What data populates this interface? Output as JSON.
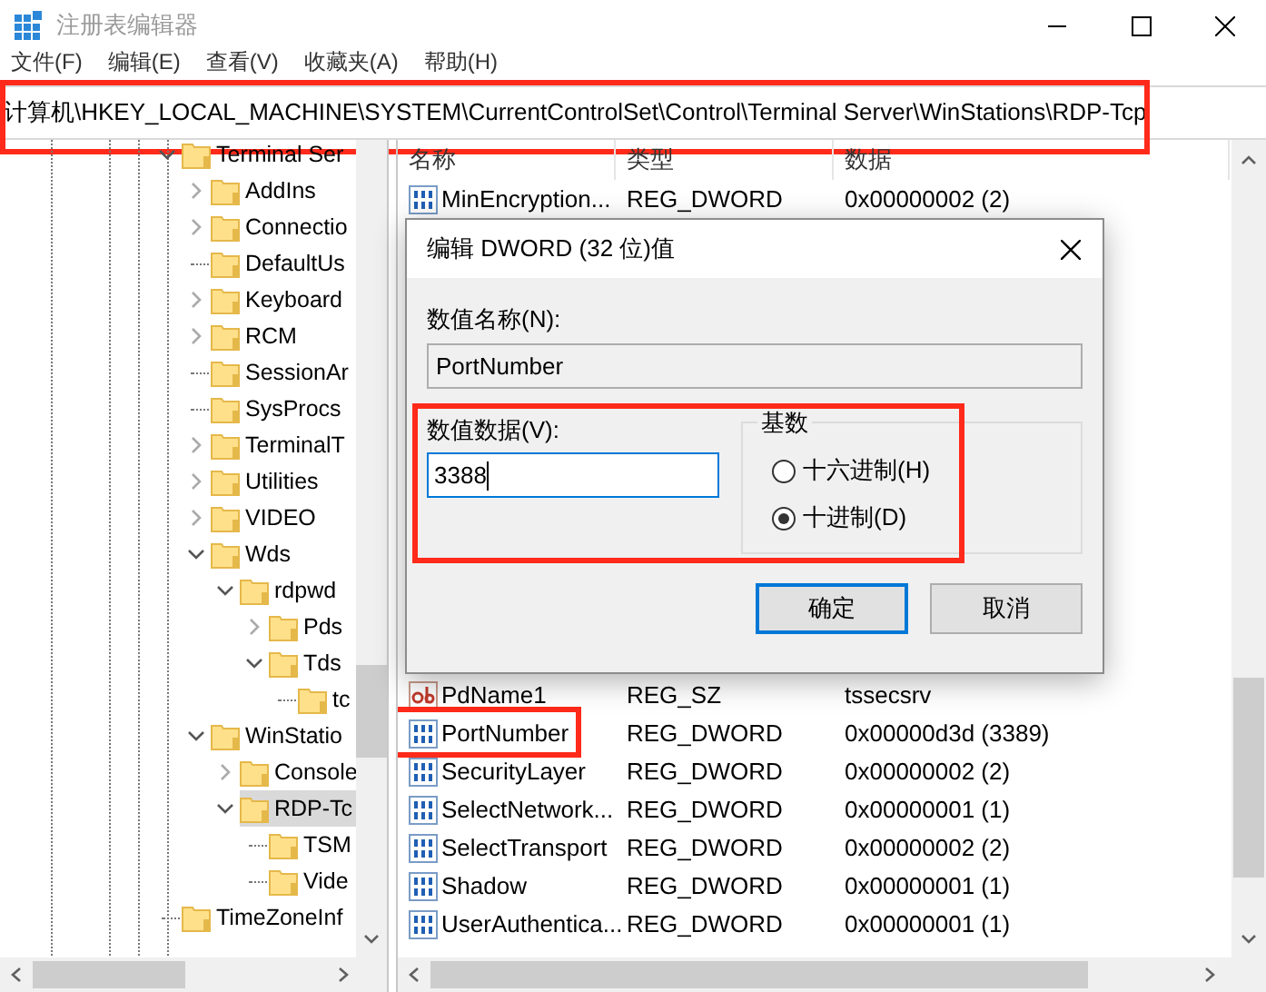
{
  "window": {
    "title": "注册表编辑器"
  },
  "menu": [
    "文件(F)",
    "编辑(E)",
    "查看(V)",
    "收藏夹(A)",
    "帮助(H)"
  ],
  "address_bar": {
    "value": "计算机\\HKEY_LOCAL_MACHINE\\SYSTEM\\CurrentControlSet\\Control\\Terminal Server\\WinStations\\RDP-Tcp",
    "highlighted": true
  },
  "tree": [
    {
      "label": "Terminal Ser",
      "kind": "branch",
      "expanded": true,
      "selected": false,
      "children": [
        {
          "label": "AddIns",
          "kind": "branch",
          "expanded": false,
          "selected": false
        },
        {
          "label": "Connectio",
          "kind": "branch",
          "expanded": false,
          "selected": false
        },
        {
          "label": "DefaultUs",
          "kind": "leaf",
          "selected": false
        },
        {
          "label": "Keyboard",
          "kind": "branch",
          "expanded": false,
          "selected": false
        },
        {
          "label": "RCM",
          "kind": "branch",
          "expanded": false,
          "selected": false
        },
        {
          "label": "SessionAr",
          "kind": "leaf",
          "selected": false
        },
        {
          "label": "SysProcs",
          "kind": "leaf",
          "selected": false
        },
        {
          "label": "TerminalT",
          "kind": "branch",
          "expanded": false,
          "selected": false
        },
        {
          "label": "Utilities",
          "kind": "branch",
          "expanded": false,
          "selected": false
        },
        {
          "label": "VIDEO",
          "kind": "branch",
          "expanded": false,
          "selected": false
        },
        {
          "label": "Wds",
          "kind": "branch",
          "expanded": true,
          "selected": false,
          "children": [
            {
              "label": "rdpwd",
              "kind": "branch",
              "expanded": true,
              "selected": false,
              "children": [
                {
                  "label": "Pds",
                  "kind": "branch",
                  "expanded": false,
                  "selected": false
                },
                {
                  "label": "Tds",
                  "kind": "branch",
                  "expanded": true,
                  "selected": false,
                  "children": [
                    {
                      "label": "tc",
                      "kind": "leaf",
                      "selected": false
                    }
                  ]
                }
              ]
            }
          ]
        },
        {
          "label": "WinStatio",
          "kind": "branch",
          "expanded": true,
          "selected": false,
          "children": [
            {
              "label": "Console",
              "kind": "branch",
              "expanded": false,
              "selected": false
            },
            {
              "label": "RDP-Tc",
              "kind": "branch",
              "expanded": true,
              "selected": true,
              "children": [
                {
                  "label": "TSM",
                  "kind": "leaf",
                  "selected": false
                },
                {
                  "label": "Vide",
                  "kind": "leaf",
                  "selected": false
                }
              ]
            }
          ]
        }
      ]
    },
    {
      "label": "TimeZoneInf",
      "kind": "leaf",
      "selected": false
    }
  ],
  "table": {
    "columns": [
      "名称",
      "类型",
      "数据"
    ],
    "rows_top": [
      {
        "kind": "dword",
        "name": "MinEncryption...",
        "type": "REG_DWORD",
        "data": "0x00000002 (2)",
        "highlighted": false
      }
    ],
    "rows_bottom": [
      {
        "kind": "string",
        "name": "PdName1",
        "type": "REG_SZ",
        "data": "tssecsrv",
        "highlighted": false
      },
      {
        "kind": "dword",
        "name": "PortNumber",
        "type": "REG_DWORD",
        "data": "0x00000d3d (3389)",
        "highlighted": true
      },
      {
        "kind": "dword",
        "name": "SecurityLayer",
        "type": "REG_DWORD",
        "data": "0x00000002 (2)",
        "highlighted": false
      },
      {
        "kind": "dword",
        "name": "SelectNetwork...",
        "type": "REG_DWORD",
        "data": "0x00000001 (1)",
        "highlighted": false
      },
      {
        "kind": "dword",
        "name": "SelectTransport",
        "type": "REG_DWORD",
        "data": "0x00000002 (2)",
        "highlighted": false
      },
      {
        "kind": "dword",
        "name": "Shadow",
        "type": "REG_DWORD",
        "data": "0x00000001 (1)",
        "highlighted": false
      },
      {
        "kind": "dword",
        "name": "UserAuthentica...",
        "type": "REG_DWORD",
        "data": "0x00000001 (1)",
        "highlighted": false
      }
    ]
  },
  "dialog": {
    "title": "编辑 DWORD (32 位)值",
    "name_label": "数值名称(N):",
    "name_value": "PortNumber",
    "data_label": "数值数据(V):",
    "data_value": "3388",
    "highlighted": true,
    "base_label": "基数",
    "bases": [
      {
        "label": "十六进制(H)",
        "selected": false
      },
      {
        "label": "十进制(D)",
        "selected": true
      }
    ],
    "buttons": [
      "确定",
      "取消"
    ]
  }
}
